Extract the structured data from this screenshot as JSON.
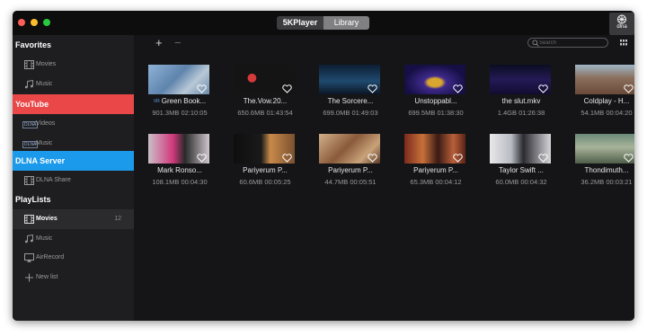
{
  "titlebar": {
    "tabs": [
      {
        "label": "5KPlayer"
      },
      {
        "label": "Library"
      }
    ],
    "dlna_button_label": "dlna"
  },
  "sidebar": {
    "favorites": {
      "title": "Favorites",
      "items": [
        {
          "label": "Movies",
          "icon": "film-icon"
        },
        {
          "label": "Music",
          "icon": "music-note-icon"
        }
      ]
    },
    "youtube": {
      "title": "YouTube",
      "color": "#e94748",
      "items": [
        {
          "label": "Videos",
          "badge": "DLNA"
        },
        {
          "label": "Music",
          "badge": "DLNA"
        }
      ]
    },
    "dlna_server": {
      "title": "DLNA Server",
      "color": "#1b99ea",
      "items": [
        {
          "label": "DLNA Share",
          "icon": "film-icon"
        }
      ]
    },
    "playlists": {
      "title": "PlayLists",
      "items": [
        {
          "label": "Movies",
          "count": "12",
          "icon": "film-icon",
          "selected": true
        },
        {
          "label": "Music",
          "icon": "music-note-icon"
        },
        {
          "label": "AirRecord",
          "icon": "airplay-icon"
        },
        {
          "label": "New list",
          "icon": "plus-icon"
        }
      ]
    }
  },
  "toolbar": {
    "add_label": "+",
    "remove_label": "−",
    "search_placeholder": "Search"
  },
  "videos": [
    {
      "title": "Green Book...",
      "size": "901.3MB",
      "duration": "02:10:05",
      "tag": "VR"
    },
    {
      "title": "The.Vow.20...",
      "size": "650.6MB",
      "duration": "01:43:54"
    },
    {
      "title": "The Sorcere...",
      "size": "699.0MB",
      "duration": "01:49:03"
    },
    {
      "title": "Unstoppabl...",
      "size": "699.5MB",
      "duration": "01:38:30"
    },
    {
      "title": "the slut.mkv",
      "size": "1.4GB",
      "duration": "01:26:38"
    },
    {
      "title": "Coldplay - H...",
      "size": "54.1MB",
      "duration": "00:04:20"
    },
    {
      "title": "Mark Ronso...",
      "size": "108.1MB",
      "duration": "00:04:30"
    },
    {
      "title": "Pariyerum P...",
      "size": "60.6MB",
      "duration": "00:05:25"
    },
    {
      "title": "Pariyerum P...",
      "size": "44.7MB",
      "duration": "00:05:51"
    },
    {
      "title": "Pariyerum P...",
      "size": "65.3MB",
      "duration": "00:04:12"
    },
    {
      "title": "Taylor Swift ...",
      "size": "60.0MB",
      "duration": "00:04:32"
    },
    {
      "title": "Thondimuth...",
      "size": "36.2MB",
      "duration": "00:03:21"
    }
  ]
}
